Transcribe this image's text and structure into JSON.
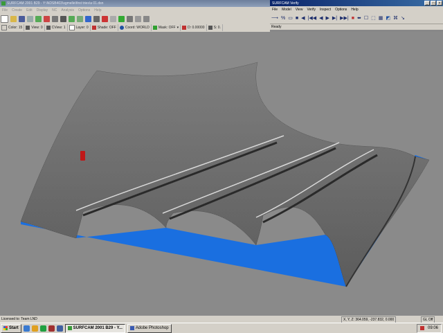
{
  "surfcam": {
    "title": "SURFCAM 2001 B29 - Y:\\NDSB403\\sgmelle\\first tries\\a 01.dsn",
    "menu": [
      "File",
      "Create",
      "Edit",
      "Display",
      "NC",
      "Analysis",
      "Options",
      "Help"
    ],
    "status_fields": [
      {
        "label": "Color: 15",
        "icon": "color-swatch-icon",
        "color": "#d4d0c8"
      },
      {
        "label": "View: 0",
        "icon": "view-icon",
        "color": "#555555"
      },
      {
        "label": "CView: 1",
        "icon": "cview-icon",
        "color": "#555555"
      },
      {
        "label": "Layer: 0",
        "icon": "layer-icon",
        "color": "#ffffff"
      },
      {
        "label": "Shade: OFF",
        "icon": "shade-icon",
        "color": "#c03030"
      },
      {
        "label": "Coord: WORLD",
        "icon": "coord-globe-icon",
        "color": "#2050a0"
      },
      {
        "label": "Mask: OFF",
        "icon": "mask-icon",
        "color": "#30a030"
      },
      {
        "label": "D: 0.00000",
        "icon": "depth-icon",
        "color": "#c03030"
      },
      {
        "label": "S: 0.",
        "icon": "step-icon",
        "color": "#555555"
      }
    ]
  },
  "verify": {
    "title": "SURFCAM Verify",
    "menu": [
      "File",
      "Model",
      "View",
      "Verify",
      "Inspect",
      "Options",
      "Help"
    ],
    "toolbar_glyphs": [
      "⟶",
      "%",
      "▭",
      "■",
      "◀",
      "|◀◀",
      "◀",
      "▶",
      "▶|",
      "▶▶|",
      "■",
      "⬌",
      "☐",
      "⬚",
      "▦",
      "◩",
      "⌘",
      "↘"
    ],
    "status": "Ready"
  },
  "statusbar": {
    "license": "Licensed to: Team LND",
    "coords": "X, Y, Z:   364.059, -237.832, 0.000",
    "mode": "GL Off"
  },
  "taskbar": {
    "start": "Start",
    "tasks": [
      "SURFCAM 2001 B29 - Y...",
      "Adobe Photoshop"
    ],
    "clock": "09:06"
  },
  "colors": {
    "viewport_bg": "#8a8a8a",
    "stock_blue": "#1a6fe0",
    "marker_red": "#c01818"
  }
}
